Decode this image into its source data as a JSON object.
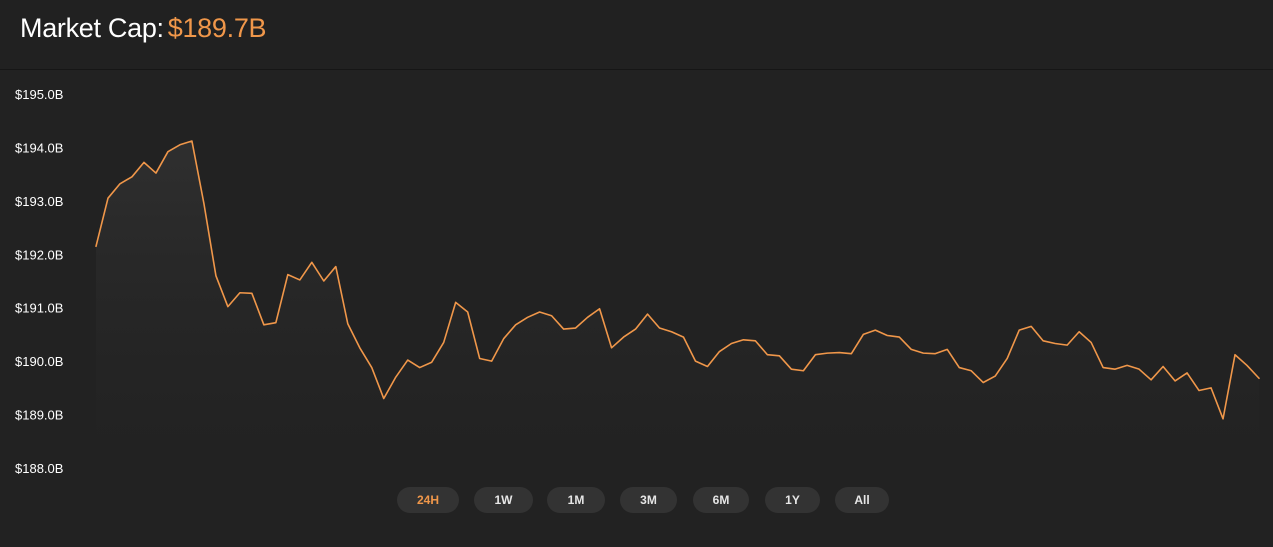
{
  "header": {
    "label": "Market Cap:",
    "value": "$189.7B"
  },
  "colors": {
    "background": "#222222",
    "line": "#f0974a",
    "accent": "#f0974a",
    "button_bg": "#333333"
  },
  "ranges": {
    "selected": "24H",
    "buttons": [
      "24H",
      "1W",
      "1M",
      "3M",
      "6M",
      "1Y",
      "All"
    ]
  },
  "chart_data": {
    "type": "area",
    "title": "",
    "xlabel": "",
    "ylabel": "",
    "ylim": [
      188.0,
      195.0
    ],
    "yticks": [
      195.0,
      194.0,
      193.0,
      192.0,
      191.0,
      190.0,
      189.0,
      188.0
    ],
    "ytick_labels": [
      "$195.0B",
      "$194.0B",
      "$193.0B",
      "$192.0B",
      "$191.0B",
      "$190.0B",
      "$189.0B",
      "$188.0B"
    ],
    "grid": false,
    "unit": "billion USD",
    "series": [
      {
        "values": [
          192.15,
          193.05,
          193.32,
          193.45,
          193.72,
          193.52,
          193.92,
          194.05,
          194.12,
          192.95,
          191.6,
          191.02,
          191.28,
          191.27,
          190.68,
          190.72,
          191.62,
          191.52,
          191.85,
          191.5,
          191.77,
          190.7,
          190.25,
          189.88,
          189.3,
          189.7,
          190.02,
          189.88,
          189.98,
          190.35,
          191.1,
          190.92,
          190.05,
          190.0,
          190.42,
          190.68,
          190.82,
          190.92,
          190.85,
          190.6,
          190.62,
          190.82,
          190.98,
          190.25,
          190.45,
          190.6,
          190.88,
          190.62,
          190.55,
          190.45,
          190.0,
          189.9,
          190.18,
          190.33,
          190.4,
          190.38,
          190.12,
          190.1,
          189.85,
          189.82,
          190.12,
          190.15,
          190.16,
          190.14,
          190.5,
          190.58,
          190.48,
          190.45,
          190.22,
          190.15,
          190.14,
          190.22,
          189.88,
          189.82,
          189.6,
          189.72,
          190.05,
          190.58,
          190.65,
          190.38,
          190.33,
          190.3,
          190.55,
          190.35,
          189.88,
          189.85,
          189.92,
          189.85,
          189.65,
          189.9,
          189.63,
          189.78,
          189.45,
          189.5,
          188.92,
          190.12,
          189.92,
          189.68
        ]
      }
    ]
  }
}
